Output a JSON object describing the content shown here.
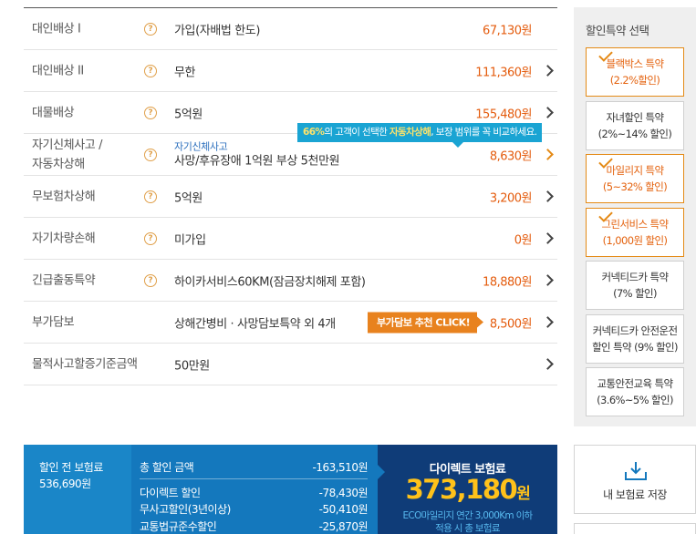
{
  "coverages": [
    {
      "name": "대인배상 Ⅰ",
      "desc": "가입(자배법 한도)",
      "price": "67,130원",
      "help": true
    },
    {
      "name": "대인배상 II",
      "desc": "무한",
      "price": "111,360원",
      "help": true
    },
    {
      "name": "대물배상",
      "desc": "5억원",
      "price": "155,480원",
      "help": true
    },
    {
      "name1": "자기신체사고 /",
      "name2": "자동차상해",
      "sub": "자기신체사고",
      "desc": "사망/후유장애 1억원 부상 5천만원",
      "price": "8,630원",
      "help": true
    },
    {
      "name": "무보험차상해",
      "desc": "5억원",
      "price": "3,200원",
      "help": true
    },
    {
      "name": "자기차량손해",
      "desc": "미가입",
      "price": "0원",
      "help": true
    },
    {
      "name": "긴급출동특약",
      "desc": "하이카서비스60KM(잠금장치해제 포함)",
      "price": "18,880원",
      "help": true
    },
    {
      "name": "부가담보",
      "desc": "상해간병비 · 사망담보특약 외 4개",
      "price": "8,500원",
      "help": false,
      "button": "부가담보 추천 CLICK!"
    },
    {
      "name": "물적사고할증기준금액",
      "desc": "50만원",
      "price": "",
      "help": false
    }
  ],
  "tooltip": {
    "p1": "66%",
    "p2": "의 고객이 선택한 ",
    "p3": "자동차상해",
    "p4": ", 보장 범위를 꼭 비교하세요."
  },
  "discounts": {
    "title": "할인특약 선택",
    "items": [
      {
        "l1": "블랙박스 특약",
        "l2": "(2.2%할인)",
        "selected": true
      },
      {
        "l1": "자녀할인 특약",
        "l2": "(2%~14% 할인)",
        "selected": false
      },
      {
        "l1": "마일리지 특약",
        "l2": "(5~32% 할인)",
        "selected": true
      },
      {
        "l1": "그린서비스 특약",
        "l2": "(1,000원 할인)",
        "selected": true
      },
      {
        "l1": "커넥티드카 특약",
        "l2": "(7% 할인)",
        "selected": false
      },
      {
        "l1": "커넥티드카 안전운전",
        "l2": "할인 특약 (9% 할인)",
        "selected": false
      },
      {
        "l1": "교통안전교육 특약",
        "l2": "(3.6%~5% 할인)",
        "selected": false
      }
    ]
  },
  "summary": {
    "before_label": "할인 전 보험료",
    "before_value": "536,690원",
    "total_label": "총 할인 금액",
    "total_value": "-163,510원",
    "lines": [
      {
        "label": "다이렉트 할인",
        "value": "-78,430원"
      },
      {
        "label": "무사고할인(3년이상)",
        "value": "-50,410원"
      },
      {
        "label": "교통법규준수할인",
        "value": "-25,870원"
      }
    ],
    "final_label": "다이렉트 보험료",
    "final_value": "373,180",
    "final_unit": "원",
    "eco_note1": "ECO마일리지 연간 3,000Km 이하",
    "eco_note2": "적용 시 총 보험료"
  },
  "save": {
    "label": "내 보험료 저장"
  },
  "colors": {
    "accent": "#e45c0e",
    "primary": "#1478bd",
    "dark": "#0f3c78",
    "highlight": "#ffc21a"
  }
}
